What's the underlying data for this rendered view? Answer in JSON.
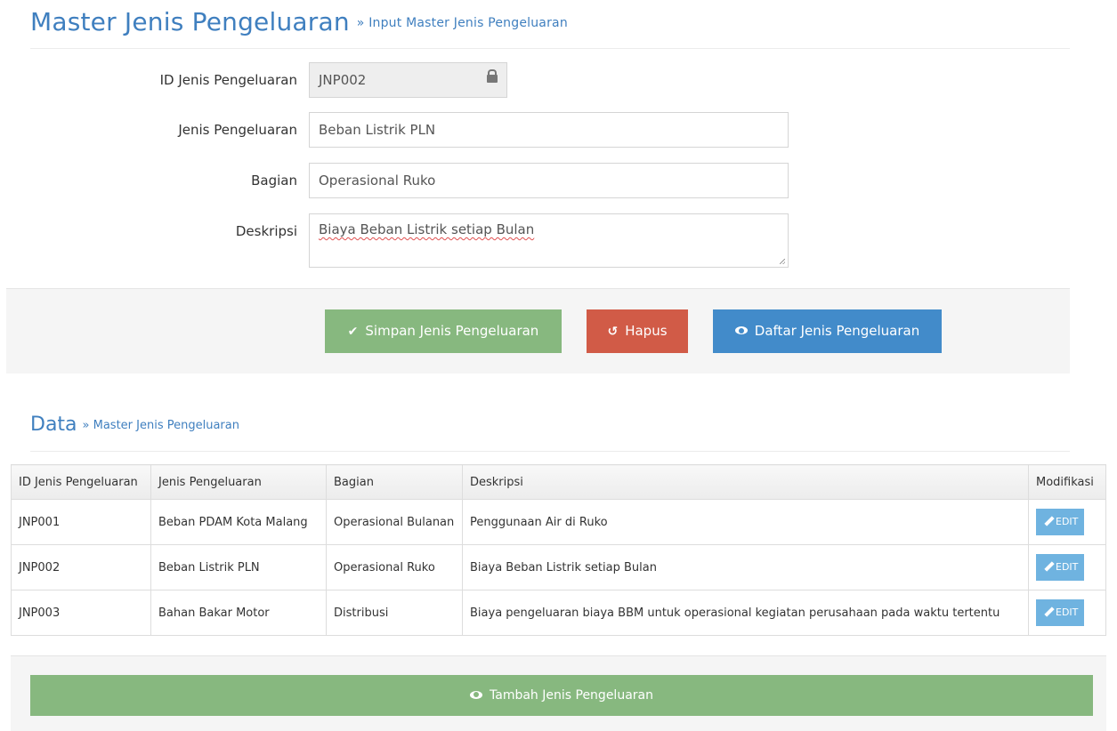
{
  "header": {
    "title": "Master Jenis Pengeluaran",
    "crumb": "» Input Master Jenis Pengeluaran"
  },
  "form": {
    "id_label": "ID Jenis Pengeluaran",
    "id_value": "JNP002",
    "jenis_label": "Jenis Pengeluaran",
    "jenis_value": "Beban Listrik PLN",
    "bagian_label": "Bagian",
    "bagian_value": "Operasional Ruko",
    "deskripsi_label": "Deskripsi",
    "deskripsi_value": "Biaya Beban Listrik setiap Bulan"
  },
  "actions": {
    "save_label": "Simpan Jenis Pengeluaran",
    "delete_label": "Hapus",
    "list_label": "Daftar Jenis Pengeluaran",
    "check_icon": "check-icon",
    "undo_icon": "undo-icon",
    "eye_icon": "eye-icon"
  },
  "data_section": {
    "title": "Data",
    "crumb": "» Master Jenis Pengeluaran"
  },
  "table": {
    "headers": [
      "ID Jenis Pengeluaran",
      "Jenis Pengeluaran",
      "Bagian",
      "Deskripsi",
      "Modifikasi"
    ],
    "rows": [
      [
        "JNP001",
        "Beban PDAM Kota Malang",
        "Operasional Bulanan",
        "Penggunaan Air di Ruko"
      ],
      [
        "JNP002",
        "Beban Listrik PLN",
        "Operasional Ruko",
        "Biaya Beban Listrik setiap Bulan"
      ],
      [
        "JNP003",
        "Bahan Bakar Motor",
        "Distribusi",
        "Biaya pengeluaran biaya BBM untuk operasional kegiatan perusahaan pada waktu tertentu"
      ]
    ],
    "edit_label": "EDIT"
  },
  "footer": {
    "add_label": "Tambah Jenis Pengeluaran"
  },
  "colors": {
    "accent": "#3f7fbf",
    "green": "#87b87f",
    "red": "#d15b47",
    "blue": "#428bca",
    "edit_blue": "#6fb3e0"
  }
}
